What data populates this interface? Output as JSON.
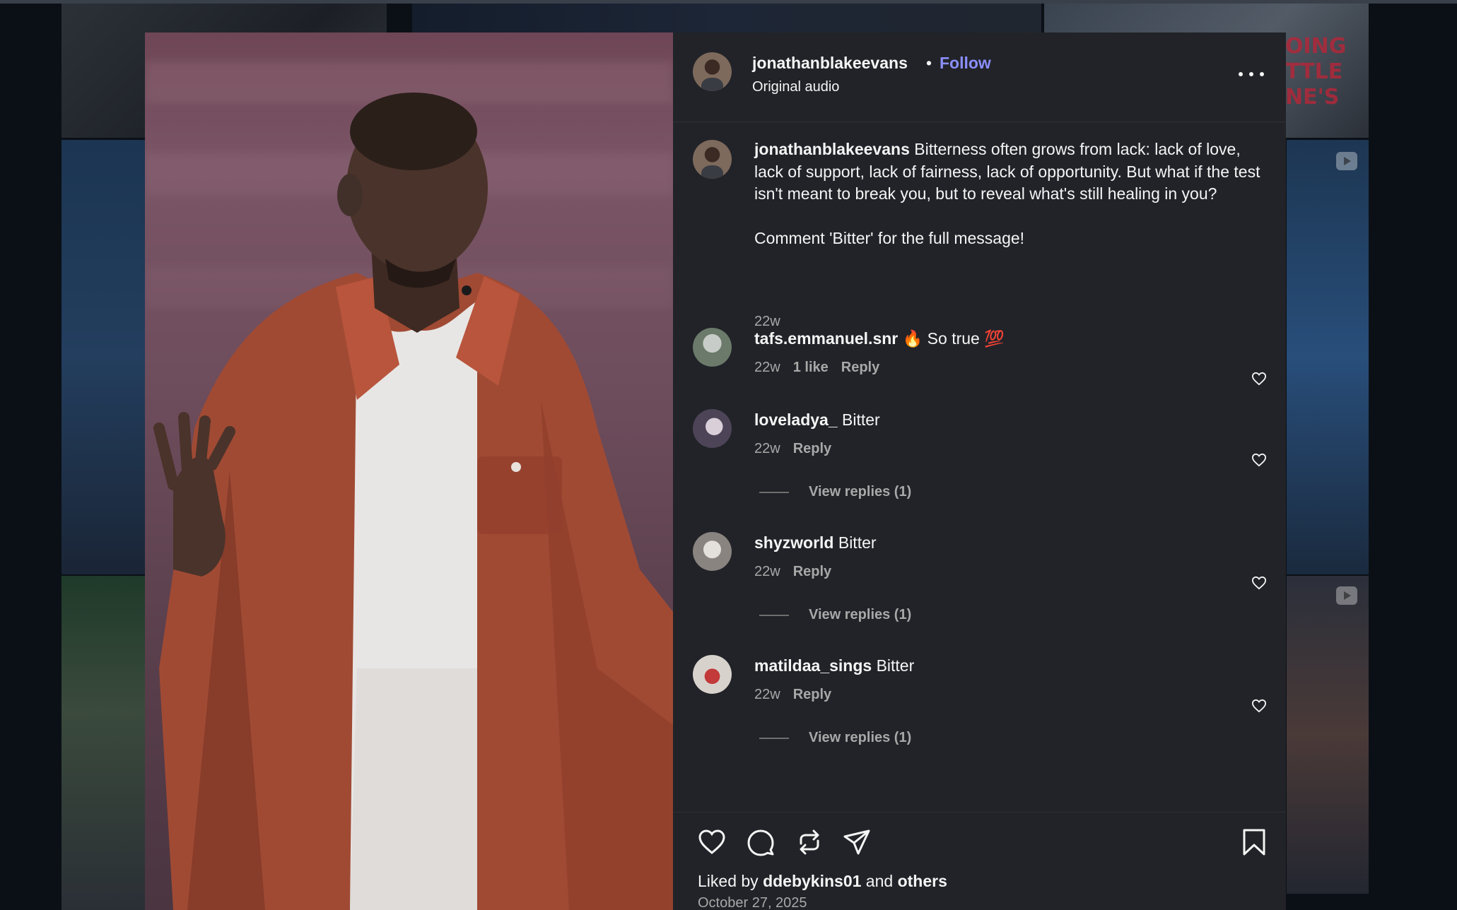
{
  "post": {
    "author": "jonathanblakeevans",
    "separator": "•",
    "follow_label": "Follow",
    "audio": "Original audio",
    "caption": "Bitterness often grows from lack: lack of love, lack of support, lack of fairness, lack of opportunity. But what if the test isn't meant to break you, but to reveal what's still healing in you?\n\nComment 'Bitter' for the full message!",
    "caption_age": "22w",
    "liked_by_prefix": "Liked by",
    "liked_by_user": "ddebykins01",
    "liked_by_and": "and",
    "liked_by_others": "others",
    "date": "October 27, 2025"
  },
  "comments": [
    {
      "user": "tafs.emmanuel.snr",
      "text": "🔥 So true 💯",
      "age": "22w",
      "likes": "1 like",
      "reply_label": "Reply",
      "view_replies": ""
    },
    {
      "user": "loveladya_",
      "text": "Bitter",
      "age": "22w",
      "likes": "",
      "reply_label": "Reply",
      "view_replies": "View replies (1)"
    },
    {
      "user": "shyzworld",
      "text": "Bitter",
      "age": "22w",
      "likes": "",
      "reply_label": "Reply",
      "view_replies": "View replies (1)"
    },
    {
      "user": "matildaa_sings",
      "text": "Bitter",
      "age": "22w",
      "likes": "",
      "reply_label": "Reply",
      "view_replies": "View replies (1)"
    }
  ],
  "background_text": "OING\nTTLE\nNE'S",
  "icons": [
    "more-options-icon",
    "like-heart-icon",
    "comment-icon",
    "repost-icon",
    "share-icon",
    "save-bookmark-icon",
    "comment-like-heart-icon"
  ],
  "colors": {
    "panel_bg": "#212328",
    "follow_accent": "#8b8efa",
    "muted_text": "#a8a8a8"
  }
}
